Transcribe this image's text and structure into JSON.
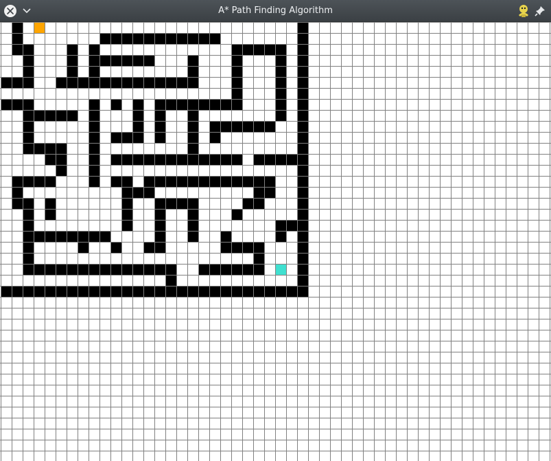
{
  "window": {
    "title": "A* Path Finding Algorithm",
    "close_icon": "close-icon",
    "menu_icon": "chevron-down-icon",
    "app_icon": "python-snake-icon",
    "pin_icon": "pin-icon"
  },
  "grid": {
    "columns": 50,
    "rows": 40,
    "colors": {
      "empty": "#ffffff",
      "grid_line": "#808080",
      "barrier": "#000000",
      "start": "#ffa500",
      "end": "#40e0d0"
    },
    "start_cell": [
      3,
      0
    ],
    "end_cell": [
      25,
      22
    ],
    "barrier_runs": [
      [
        0,
        1,
        1
      ],
      [
        1,
        1,
        1
      ],
      [
        1,
        9,
        19
      ],
      [
        2,
        1,
        2
      ],
      [
        2,
        6,
        6
      ],
      [
        2,
        8,
        8
      ],
      [
        2,
        21,
        25
      ],
      [
        3,
        2,
        2
      ],
      [
        3,
        6,
        6
      ],
      [
        3,
        8,
        13
      ],
      [
        3,
        17,
        17
      ],
      [
        3,
        21,
        21
      ],
      [
        3,
        25,
        25
      ],
      [
        4,
        2,
        2
      ],
      [
        4,
        6,
        6
      ],
      [
        4,
        8,
        8
      ],
      [
        4,
        17,
        17
      ],
      [
        4,
        21,
        21
      ],
      [
        4,
        25,
        25
      ],
      [
        5,
        0,
        2
      ],
      [
        5,
        5,
        17
      ],
      [
        5,
        21,
        21
      ],
      [
        5,
        25,
        25
      ],
      [
        6,
        21,
        21
      ],
      [
        6,
        25,
        25
      ],
      [
        7,
        0,
        2
      ],
      [
        7,
        8,
        8
      ],
      [
        7,
        10,
        10
      ],
      [
        7,
        12,
        12
      ],
      [
        7,
        14,
        21
      ],
      [
        7,
        25,
        25
      ],
      [
        8,
        2,
        6
      ],
      [
        8,
        8,
        8
      ],
      [
        8,
        12,
        12
      ],
      [
        8,
        14,
        14
      ],
      [
        8,
        17,
        17
      ],
      [
        8,
        25,
        25
      ],
      [
        9,
        2,
        2
      ],
      [
        9,
        8,
        8
      ],
      [
        9,
        12,
        12
      ],
      [
        9,
        14,
        14
      ],
      [
        9,
        17,
        17
      ],
      [
        9,
        19,
        24
      ],
      [
        10,
        2,
        2
      ],
      [
        10,
        8,
        8
      ],
      [
        10,
        10,
        12
      ],
      [
        10,
        14,
        14
      ],
      [
        10,
        17,
        17
      ],
      [
        10,
        19,
        19
      ],
      [
        11,
        2,
        5
      ],
      [
        11,
        8,
        8
      ],
      [
        11,
        17,
        17
      ],
      [
        12,
        4,
        5
      ],
      [
        12,
        8,
        8
      ],
      [
        12,
        10,
        21
      ],
      [
        12,
        23,
        26
      ],
      [
        13,
        5,
        5
      ],
      [
        13,
        8,
        8
      ],
      [
        14,
        1,
        4
      ],
      [
        14,
        8,
        8
      ],
      [
        14,
        10,
        11
      ],
      [
        14,
        13,
        24
      ],
      [
        15,
        1,
        1
      ],
      [
        15,
        11,
        13
      ],
      [
        15,
        23,
        24
      ],
      [
        16,
        1,
        2
      ],
      [
        16,
        4,
        4
      ],
      [
        16,
        11,
        11
      ],
      [
        16,
        14,
        17
      ],
      [
        16,
        22,
        23
      ],
      [
        17,
        2,
        2
      ],
      [
        17,
        4,
        4
      ],
      [
        17,
        11,
        11
      ],
      [
        17,
        14,
        14
      ],
      [
        17,
        17,
        17
      ],
      [
        17,
        21,
        21
      ],
      [
        18,
        2,
        2
      ],
      [
        18,
        11,
        11
      ],
      [
        18,
        14,
        14
      ],
      [
        18,
        17,
        17
      ],
      [
        18,
        25,
        26
      ],
      [
        19,
        2,
        9
      ],
      [
        19,
        14,
        14
      ],
      [
        19,
        17,
        17
      ],
      [
        19,
        20,
        20
      ],
      [
        19,
        25,
        25
      ],
      [
        20,
        2,
        2
      ],
      [
        20,
        7,
        7
      ],
      [
        20,
        10,
        10
      ],
      [
        20,
        13,
        14
      ],
      [
        20,
        20,
        23
      ],
      [
        21,
        2,
        2
      ],
      [
        21,
        23,
        23
      ],
      [
        22,
        2,
        15
      ],
      [
        22,
        18,
        23
      ],
      [
        23,
        15,
        15
      ],
      [
        24,
        0,
        27
      ]
    ],
    "barrier_column": {
      "col": 27,
      "from_row": 0,
      "to_row": 24
    }
  }
}
